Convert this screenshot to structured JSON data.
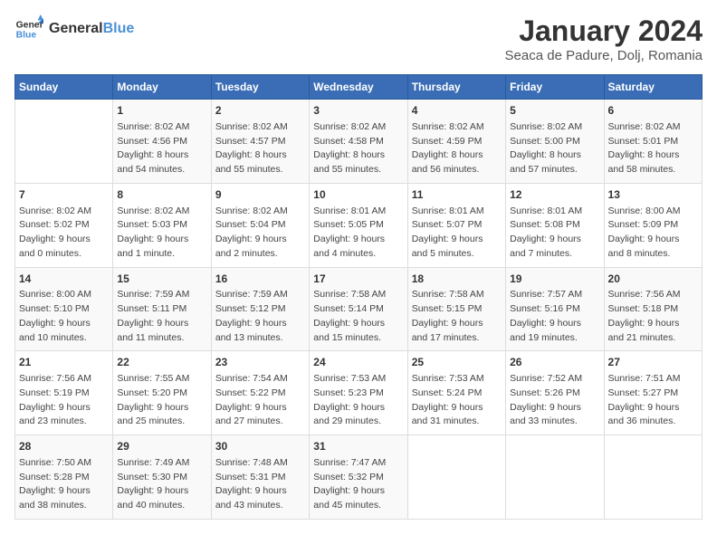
{
  "header": {
    "logo_text_general": "General",
    "logo_text_blue": "Blue",
    "month_title": "January 2024",
    "subtitle": "Seaca de Padure, Dolj, Romania"
  },
  "days_of_week": [
    "Sunday",
    "Monday",
    "Tuesday",
    "Wednesday",
    "Thursday",
    "Friday",
    "Saturday"
  ],
  "weeks": [
    [
      {
        "day": "",
        "info": ""
      },
      {
        "day": "1",
        "info": "Sunrise: 8:02 AM\nSunset: 4:56 PM\nDaylight: 8 hours\nand 54 minutes."
      },
      {
        "day": "2",
        "info": "Sunrise: 8:02 AM\nSunset: 4:57 PM\nDaylight: 8 hours\nand 55 minutes."
      },
      {
        "day": "3",
        "info": "Sunrise: 8:02 AM\nSunset: 4:58 PM\nDaylight: 8 hours\nand 55 minutes."
      },
      {
        "day": "4",
        "info": "Sunrise: 8:02 AM\nSunset: 4:59 PM\nDaylight: 8 hours\nand 56 minutes."
      },
      {
        "day": "5",
        "info": "Sunrise: 8:02 AM\nSunset: 5:00 PM\nDaylight: 8 hours\nand 57 minutes."
      },
      {
        "day": "6",
        "info": "Sunrise: 8:02 AM\nSunset: 5:01 PM\nDaylight: 8 hours\nand 58 minutes."
      }
    ],
    [
      {
        "day": "7",
        "info": "Sunrise: 8:02 AM\nSunset: 5:02 PM\nDaylight: 9 hours\nand 0 minutes."
      },
      {
        "day": "8",
        "info": "Sunrise: 8:02 AM\nSunset: 5:03 PM\nDaylight: 9 hours\nand 1 minute."
      },
      {
        "day": "9",
        "info": "Sunrise: 8:02 AM\nSunset: 5:04 PM\nDaylight: 9 hours\nand 2 minutes."
      },
      {
        "day": "10",
        "info": "Sunrise: 8:01 AM\nSunset: 5:05 PM\nDaylight: 9 hours\nand 4 minutes."
      },
      {
        "day": "11",
        "info": "Sunrise: 8:01 AM\nSunset: 5:07 PM\nDaylight: 9 hours\nand 5 minutes."
      },
      {
        "day": "12",
        "info": "Sunrise: 8:01 AM\nSunset: 5:08 PM\nDaylight: 9 hours\nand 7 minutes."
      },
      {
        "day": "13",
        "info": "Sunrise: 8:00 AM\nSunset: 5:09 PM\nDaylight: 9 hours\nand 8 minutes."
      }
    ],
    [
      {
        "day": "14",
        "info": "Sunrise: 8:00 AM\nSunset: 5:10 PM\nDaylight: 9 hours\nand 10 minutes."
      },
      {
        "day": "15",
        "info": "Sunrise: 7:59 AM\nSunset: 5:11 PM\nDaylight: 9 hours\nand 11 minutes."
      },
      {
        "day": "16",
        "info": "Sunrise: 7:59 AM\nSunset: 5:12 PM\nDaylight: 9 hours\nand 13 minutes."
      },
      {
        "day": "17",
        "info": "Sunrise: 7:58 AM\nSunset: 5:14 PM\nDaylight: 9 hours\nand 15 minutes."
      },
      {
        "day": "18",
        "info": "Sunrise: 7:58 AM\nSunset: 5:15 PM\nDaylight: 9 hours\nand 17 minutes."
      },
      {
        "day": "19",
        "info": "Sunrise: 7:57 AM\nSunset: 5:16 PM\nDaylight: 9 hours\nand 19 minutes."
      },
      {
        "day": "20",
        "info": "Sunrise: 7:56 AM\nSunset: 5:18 PM\nDaylight: 9 hours\nand 21 minutes."
      }
    ],
    [
      {
        "day": "21",
        "info": "Sunrise: 7:56 AM\nSunset: 5:19 PM\nDaylight: 9 hours\nand 23 minutes."
      },
      {
        "day": "22",
        "info": "Sunrise: 7:55 AM\nSunset: 5:20 PM\nDaylight: 9 hours\nand 25 minutes."
      },
      {
        "day": "23",
        "info": "Sunrise: 7:54 AM\nSunset: 5:22 PM\nDaylight: 9 hours\nand 27 minutes."
      },
      {
        "day": "24",
        "info": "Sunrise: 7:53 AM\nSunset: 5:23 PM\nDaylight: 9 hours\nand 29 minutes."
      },
      {
        "day": "25",
        "info": "Sunrise: 7:53 AM\nSunset: 5:24 PM\nDaylight: 9 hours\nand 31 minutes."
      },
      {
        "day": "26",
        "info": "Sunrise: 7:52 AM\nSunset: 5:26 PM\nDaylight: 9 hours\nand 33 minutes."
      },
      {
        "day": "27",
        "info": "Sunrise: 7:51 AM\nSunset: 5:27 PM\nDaylight: 9 hours\nand 36 minutes."
      }
    ],
    [
      {
        "day": "28",
        "info": "Sunrise: 7:50 AM\nSunset: 5:28 PM\nDaylight: 9 hours\nand 38 minutes."
      },
      {
        "day": "29",
        "info": "Sunrise: 7:49 AM\nSunset: 5:30 PM\nDaylight: 9 hours\nand 40 minutes."
      },
      {
        "day": "30",
        "info": "Sunrise: 7:48 AM\nSunset: 5:31 PM\nDaylight: 9 hours\nand 43 minutes."
      },
      {
        "day": "31",
        "info": "Sunrise: 7:47 AM\nSunset: 5:32 PM\nDaylight: 9 hours\nand 45 minutes."
      },
      {
        "day": "",
        "info": ""
      },
      {
        "day": "",
        "info": ""
      },
      {
        "day": "",
        "info": ""
      }
    ]
  ]
}
